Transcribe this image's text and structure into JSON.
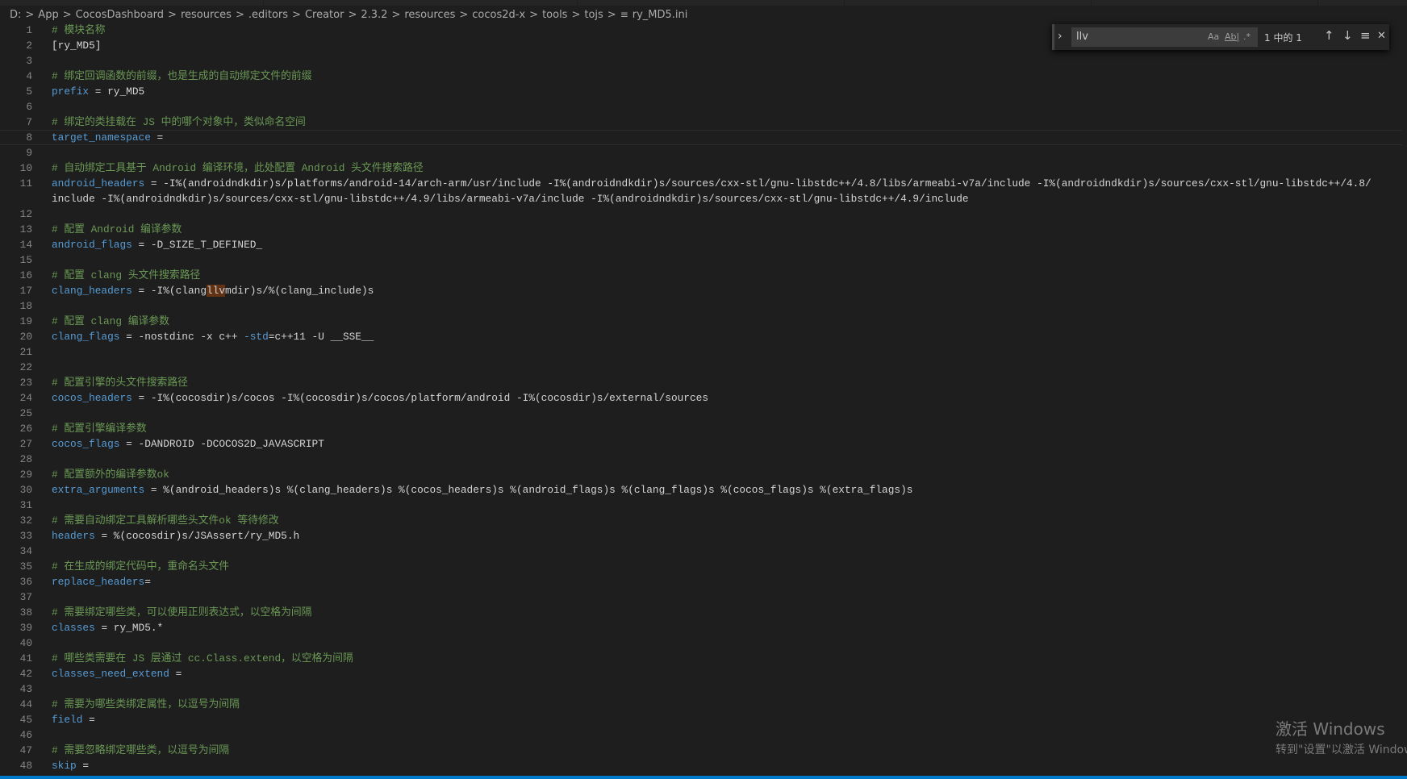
{
  "breadcrumb": [
    "D:",
    "App",
    "CocosDashboard",
    "resources",
    ".editors",
    "Creator",
    "2.3.2",
    "resources",
    "cocos2d-x",
    "tools",
    "tojs"
  ],
  "breadcrumb_file": "ry_MD5.ini",
  "breadcrumb_separator": ">",
  "file_icon": "≡",
  "current_line": 8,
  "lines": [
    {
      "n": "1",
      "segs": [
        {
          "t": "# 模块名称",
          "c": "cm"
        }
      ]
    },
    {
      "n": "2",
      "segs": [
        {
          "t": "[ry_MD5]",
          "c": "val"
        }
      ]
    },
    {
      "n": "3",
      "segs": []
    },
    {
      "n": "4",
      "segs": [
        {
          "t": "# 绑定回调函数的前缀，也是生成的自动绑定文件的前缀",
          "c": "cm"
        }
      ]
    },
    {
      "n": "5",
      "segs": [
        {
          "t": "prefix",
          "c": "key"
        },
        {
          "t": " = ry_MD5",
          "c": "val"
        }
      ]
    },
    {
      "n": "6",
      "segs": []
    },
    {
      "n": "7",
      "segs": [
        {
          "t": "# 绑定的类挂载在 JS 中的哪个对象中，类似命名空间",
          "c": "cm"
        }
      ]
    },
    {
      "n": "8",
      "segs": [
        {
          "t": "target_namespace",
          "c": "key"
        },
        {
          "t": " =",
          "c": "val"
        }
      ]
    },
    {
      "n": "9",
      "segs": []
    },
    {
      "n": "10",
      "segs": [
        {
          "t": "# 自动绑定工具基于 Android 编译环境，此处配置 Android 头文件搜索路径",
          "c": "cm"
        }
      ]
    },
    {
      "n": "11",
      "segs": [
        {
          "t": "android_headers",
          "c": "key"
        },
        {
          "t": " = -I%(androidndkdir)s/platforms/android-14/arch-arm/usr/include -I%(androidndkdir)s/sources/cxx-stl/gnu-libstdc++/4.8/libs/armeabi-v7a/include -I%(androidndkdir)s/sources/cxx-stl/gnu-libstdc++/4.8/",
          "c": "val"
        }
      ]
    },
    {
      "n": "",
      "segs": [
        {
          "t": "include -I%(androidndkdir)s/sources/cxx-stl/gnu-libstdc++/4.9/libs/armeabi-v7a/include -I%(androidndkdir)s/sources/cxx-stl/gnu-libstdc++/4.9/include",
          "c": "val"
        }
      ]
    },
    {
      "n": "12",
      "segs": []
    },
    {
      "n": "13",
      "segs": [
        {
          "t": "# 配置 Android 编译参数",
          "c": "cm"
        }
      ]
    },
    {
      "n": "14",
      "segs": [
        {
          "t": "android_flags",
          "c": "key"
        },
        {
          "t": " = -D_SIZE_T_DEFINED_",
          "c": "val"
        }
      ]
    },
    {
      "n": "15",
      "segs": []
    },
    {
      "n": "16",
      "segs": [
        {
          "t": "# 配置 clang 头文件搜索路径",
          "c": "cm"
        }
      ]
    },
    {
      "n": "17",
      "segs": [
        {
          "t": "clang_headers",
          "c": "key"
        },
        {
          "t": " = -I%(clang",
          "c": "val"
        },
        {
          "t": "llv",
          "c": "val match"
        },
        {
          "t": "mdir)s/%(clang_include)s",
          "c": "val"
        }
      ]
    },
    {
      "n": "18",
      "segs": []
    },
    {
      "n": "19",
      "segs": [
        {
          "t": "# 配置 clang 编译参数",
          "c": "cm"
        }
      ]
    },
    {
      "n": "20",
      "segs": [
        {
          "t": "clang_flags",
          "c": "key"
        },
        {
          "t": " = -nostdinc -x c++ ",
          "c": "val"
        },
        {
          "t": "-std",
          "c": "key"
        },
        {
          "t": "=c++11 -U __SSE__",
          "c": "val"
        }
      ]
    },
    {
      "n": "21",
      "segs": []
    },
    {
      "n": "22",
      "segs": []
    },
    {
      "n": "23",
      "segs": [
        {
          "t": "# 配置引擎的头文件搜索路径",
          "c": "cm"
        }
      ]
    },
    {
      "n": "24",
      "segs": [
        {
          "t": "cocos_headers",
          "c": "key"
        },
        {
          "t": " = -I%(cocosdir)s/cocos -I%(cocosdir)s/cocos/platform/android -I%(cocosdir)s/external/sources",
          "c": "val"
        }
      ]
    },
    {
      "n": "25",
      "segs": []
    },
    {
      "n": "26",
      "segs": [
        {
          "t": "# 配置引擎编译参数",
          "c": "cm"
        }
      ]
    },
    {
      "n": "27",
      "segs": [
        {
          "t": "cocos_flags",
          "c": "key"
        },
        {
          "t": " = -DANDROID -DCOCOS2D_JAVASCRIPT",
          "c": "val"
        }
      ]
    },
    {
      "n": "28",
      "segs": []
    },
    {
      "n": "29",
      "segs": [
        {
          "t": "# 配置额外的编译参数ok",
          "c": "cm"
        }
      ]
    },
    {
      "n": "30",
      "segs": [
        {
          "t": "extra_arguments",
          "c": "key"
        },
        {
          "t": " = %(android_headers)s %(clang_headers)s %(cocos_headers)s %(android_flags)s %(clang_flags)s %(cocos_flags)s %(extra_flags)s",
          "c": "val"
        }
      ]
    },
    {
      "n": "31",
      "segs": []
    },
    {
      "n": "32",
      "segs": [
        {
          "t": "# 需要自动绑定工具解析哪些头文件ok 等待修改",
          "c": "cm"
        }
      ]
    },
    {
      "n": "33",
      "segs": [
        {
          "t": "headers",
          "c": "key"
        },
        {
          "t": " = %(cocosdir)s/JSAssert/ry_MD5.h",
          "c": "val"
        }
      ]
    },
    {
      "n": "34",
      "segs": []
    },
    {
      "n": "35",
      "segs": [
        {
          "t": "# 在生成的绑定代码中，重命名头文件",
          "c": "cm"
        }
      ]
    },
    {
      "n": "36",
      "segs": [
        {
          "t": "replace_headers",
          "c": "key"
        },
        {
          "t": "=",
          "c": "val"
        }
      ]
    },
    {
      "n": "37",
      "segs": []
    },
    {
      "n": "38",
      "segs": [
        {
          "t": "# 需要绑定哪些类，可以使用正则表达式，以空格为间隔",
          "c": "cm"
        }
      ]
    },
    {
      "n": "39",
      "segs": [
        {
          "t": "classes",
          "c": "key"
        },
        {
          "t": " = ry_MD5.*",
          "c": "val"
        }
      ]
    },
    {
      "n": "40",
      "segs": []
    },
    {
      "n": "41",
      "segs": [
        {
          "t": "# 哪些类需要在 JS 层通过 cc.Class.extend，以空格为间隔",
          "c": "cm"
        }
      ]
    },
    {
      "n": "42",
      "segs": [
        {
          "t": "classes_need_extend",
          "c": "key"
        },
        {
          "t": " =",
          "c": "val"
        }
      ]
    },
    {
      "n": "43",
      "segs": []
    },
    {
      "n": "44",
      "segs": [
        {
          "t": "# 需要为哪些类绑定属性，以逗号为间隔",
          "c": "cm"
        }
      ]
    },
    {
      "n": "45",
      "segs": [
        {
          "t": "field",
          "c": "key"
        },
        {
          "t": " =",
          "c": "val"
        }
      ]
    },
    {
      "n": "46",
      "segs": []
    },
    {
      "n": "47",
      "segs": [
        {
          "t": "# 需要忽略绑定哪些类，以逗号为间隔",
          "c": "cm"
        }
      ]
    },
    {
      "n": "48",
      "segs": [
        {
          "t": "skip",
          "c": "key"
        },
        {
          "t": " =",
          "c": "val"
        }
      ]
    }
  ],
  "find": {
    "toggle_icon": "›",
    "query": "llv",
    "match_case": "Aa",
    "whole_word": "Ab|",
    "regex": ".*",
    "count": "1 中的 1",
    "prev_icon": "↑",
    "next_icon": "↓",
    "selection_icon": "≡",
    "close_icon": "✕"
  },
  "watermark": {
    "line1": "激活 Windows",
    "line2": "转到\"设置\"以激活 Windows。"
  },
  "colors": {
    "background": "#1e1e1e",
    "key": "#569cd6",
    "comment": "#6a9955",
    "text": "#d4d4d4",
    "match": "#613214",
    "statusbar": "#007acc"
  }
}
